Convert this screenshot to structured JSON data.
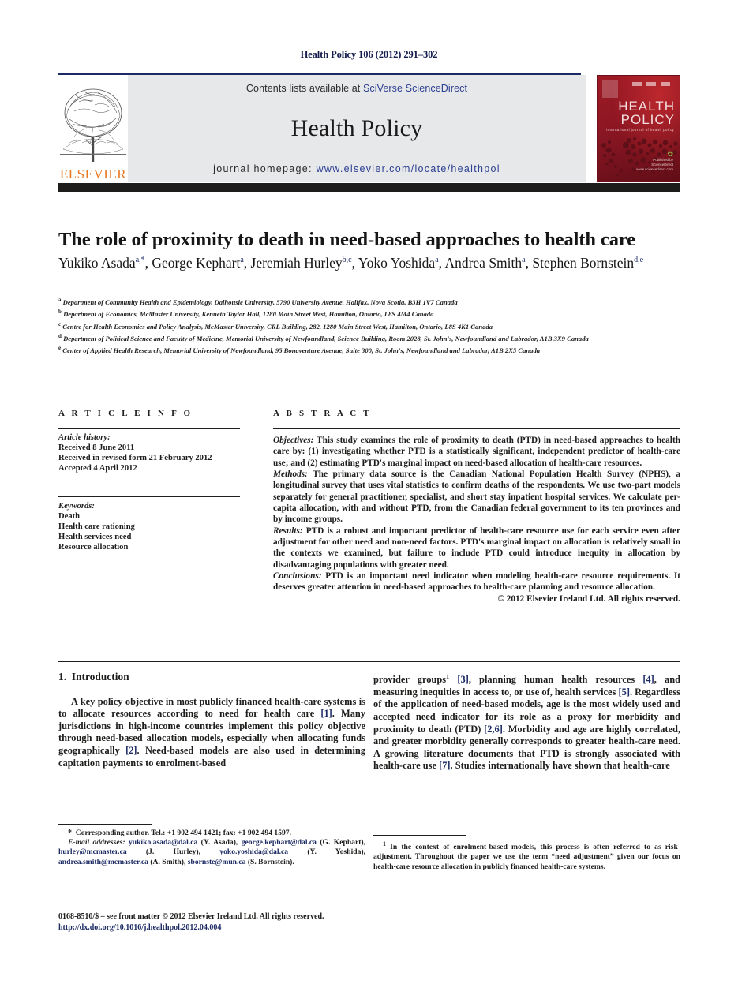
{
  "running_head": "Health Policy 106 (2012) 291–302",
  "masthead": {
    "contents_prefix": "Contents lists available at ",
    "contents_link": "SciVerse ScienceDirect",
    "journal_title": "Health Policy",
    "homepage_prefix": "journal homepage: ",
    "homepage_url": "www.elsevier.com/locate/healthpol",
    "publisher_wordmark": "ELSEVIER",
    "cover": {
      "title_line1": "HEALTH",
      "title_line2": "POLICY",
      "subtitle": "international journal of health policy",
      "badge_line1": "Published by",
      "badge_line2": "ScienceDirect",
      "badge_line3": "www.sciencedirect.com"
    },
    "colors": {
      "rule_blue": "#1b2a63",
      "link_blue": "#2b3f93",
      "panel_gray": "#e7e8ea",
      "elsevier_orange": "#e87722",
      "cover_red": "#8d1724",
      "black_bar": "#1d1d1b"
    }
  },
  "article": {
    "title": "The role of proximity to death in need-based approaches to health care",
    "authors": [
      {
        "name": "Yukiko Asada",
        "marks": "a,*"
      },
      {
        "name": "George Kephart",
        "marks": "a"
      },
      {
        "name": "Jeremiah Hurley",
        "marks": "b,c"
      },
      {
        "name": "Yoko Yoshida",
        "marks": "a"
      },
      {
        "name": "Andrea Smith",
        "marks": "a"
      },
      {
        "name": "Stephen Bornstein",
        "marks": "d,e"
      }
    ],
    "affiliations": [
      {
        "mark": "a",
        "text": "Department of Community Health and Epidemiology, Dalhousie University, 5790 University Avenue, Halifax, Nova Scotia, B3H 1V7 Canada"
      },
      {
        "mark": "b",
        "text": "Department of Economics, McMaster University, Kenneth Taylor Hall, 1280 Main Street West, Hamilton, Ontario, L8S 4M4 Canada"
      },
      {
        "mark": "c",
        "text": "Centre for Health Economics and Policy Analysis, McMaster University, CRL Building, 282, 1280 Main Street West, Hamilton, Ontario, L8S 4K1 Canada"
      },
      {
        "mark": "d",
        "text": "Department of Political Science and Faculty of Medicine, Memorial University of Newfoundland, Science Building, Room 2028, St. John's, Newfoundland and Labrador, A1B 3X9 Canada"
      },
      {
        "mark": "e",
        "text": "Center of Applied Health Research, Memorial University of Newfoundland, 95 Bonaventure Avenue, Suite 300, St. John's, Newfoundland and Labrador, A1B 2X5 Canada"
      }
    ]
  },
  "article_info": {
    "heading": "A R T I C L E   I N F O",
    "history_label": "Article history:",
    "history": [
      "Received 8 June 2011",
      "Received in revised form 21 February 2012",
      "Accepted 4 April 2012"
    ],
    "keywords_label": "Keywords:",
    "keywords": [
      "Death",
      "Health care rationing",
      "Health services need",
      "Resource allocation"
    ]
  },
  "abstract": {
    "heading": "A B S T R A C T",
    "sections": [
      {
        "label": "Objectives:",
        "text": " This study examines the role of proximity to death (PTD) in need-based approaches to health care by: (1) investigating whether PTD is a statistically significant, independent predictor of health-care use; and (2) estimating PTD's marginal impact on need-based allocation of health-care resources."
      },
      {
        "label": "Methods:",
        "text": " The primary data source is the Canadian National Population Health Survey (NPHS), a longitudinal survey that uses vital statistics to confirm deaths of the respondents. We use two-part models separately for general practitioner, specialist, and short stay inpatient hospital services. We calculate per-capita allocation, with and without PTD, from the Canadian federal government to its ten provinces and by income groups."
      },
      {
        "label": "Results:",
        "text": " PTD is a robust and important predictor of health-care resource use for each service even after adjustment for other need and non-need factors. PTD's marginal impact on allocation is relatively small in the contexts we examined, but failure to include PTD could introduce inequity in allocation by disadvantaging populations with greater need."
      },
      {
        "label": "Conclusions:",
        "text": " PTD is an important need indicator when modeling health-care resource requirements. It deserves greater attention in need-based approaches to health-care planning and resource allocation."
      }
    ],
    "copyright": "© 2012 Elsevier Ireland Ltd. All rights reserved."
  },
  "body": {
    "section_number": "1.",
    "section_title": "Introduction",
    "left_paragraph_parts": [
      "A key policy objective in most publicly financed health-care systems is to allocate resources according to need for health care ",
      "[1]",
      ". Many jurisdictions in high-income countries implement this policy objective through need-based allocation models, especially when allocating funds geographically ",
      "[2]",
      ". Need-based models are also used in determining capitation payments to enrolment-based"
    ],
    "right_paragraph_parts": [
      "provider groups",
      "1",
      " ",
      "[3]",
      ", planning human health resources ",
      "[4]",
      ", and measuring inequities in access to, or use of, health services ",
      "[5]",
      ". Regardless of the application of need-based models, age is the most widely used and accepted need indicator for its role as a proxy for morbidity and proximity to death (PTD) ",
      "[2,6]",
      ". Morbidity and age are highly correlated, and greater morbidity generally corresponds to greater health-care need. A growing literature documents that PTD is strongly associated with health-care use ",
      "[7]",
      ". Studies internationally have shown that health-care"
    ]
  },
  "footnotes": {
    "corresponding": {
      "star": "*",
      "line1": "Corresponding author. Tel.: +1 902 494 1421; fax: +1 902 494 1597.",
      "emails_label": "E-mail addresses:",
      "emails": [
        {
          "address": "yukiko.asada@dal.ca",
          "owner": " (Y. Asada),"
        },
        {
          "address": "george.kephart@dal.ca",
          "owner": " (G. Kephart),"
        },
        {
          "address": "hurley@mcmaster.ca",
          "owner": " (J. Hurley),"
        },
        {
          "address": "yoko.yoshida@dal.ca",
          "owner": " (Y. Yoshida),"
        },
        {
          "address": "andrea.smith@mcmaster.ca",
          "owner": " (A. Smith),"
        },
        {
          "address": "sbornste@mun.ca",
          "owner": " (S. Bornstein)."
        }
      ]
    },
    "note1": {
      "marker": "1",
      "text": " In the context of enrolment-based models, this process is often referred to as risk-adjustment. Throughout the paper we use the term “need adjustment” given our focus on health-care resource allocation in publicly financed health-care systems."
    }
  },
  "issn": {
    "line": "0168-8510/$ – see front matter © 2012 Elsevier Ireland Ltd. All rights reserved.",
    "doi": "http://dx.doi.org/10.1016/j.healthpol.2012.04.004"
  }
}
